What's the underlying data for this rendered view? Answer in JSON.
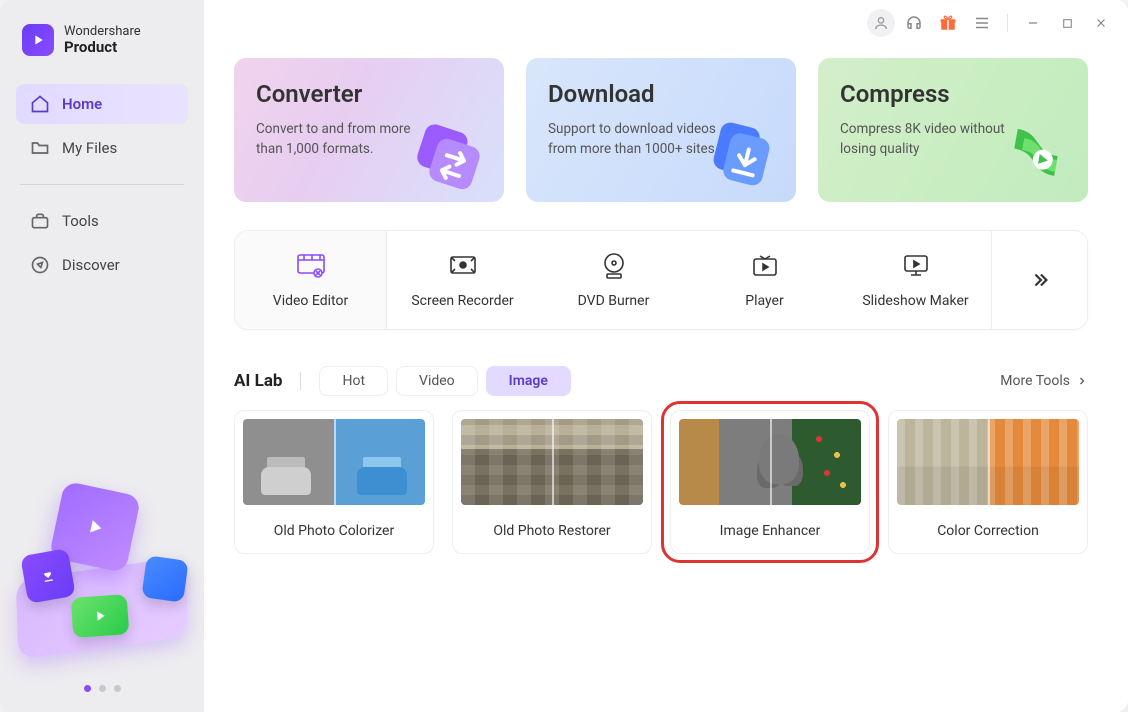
{
  "brand": {
    "line1": "Wondershare",
    "line2": "Product"
  },
  "sidebar": {
    "items": [
      {
        "label": "Home"
      },
      {
        "label": "My Files"
      },
      {
        "label": "Tools"
      },
      {
        "label": "Discover"
      }
    ]
  },
  "hero": {
    "convert": {
      "title": "Converter",
      "desc": "Convert to and from more than 1,000 formats."
    },
    "download": {
      "title": "Download",
      "desc": "Support to download videos from more than 1000+ sites."
    },
    "compress": {
      "title": "Compress",
      "desc": "Compress 8K video without losing quality"
    }
  },
  "tools": [
    {
      "label": "Video Editor"
    },
    {
      "label": "Screen Recorder"
    },
    {
      "label": "DVD Burner"
    },
    {
      "label": "Player"
    },
    {
      "label": "Slideshow Maker"
    }
  ],
  "ailab": {
    "title": "AI Lab",
    "tabs": [
      "Hot",
      "Video",
      "Image"
    ],
    "more": "More Tools",
    "cards": [
      {
        "label": "Old Photo Colorizer"
      },
      {
        "label": "Old Photo Restorer"
      },
      {
        "label": "Image Enhancer"
      },
      {
        "label": "Color Correction"
      }
    ]
  }
}
